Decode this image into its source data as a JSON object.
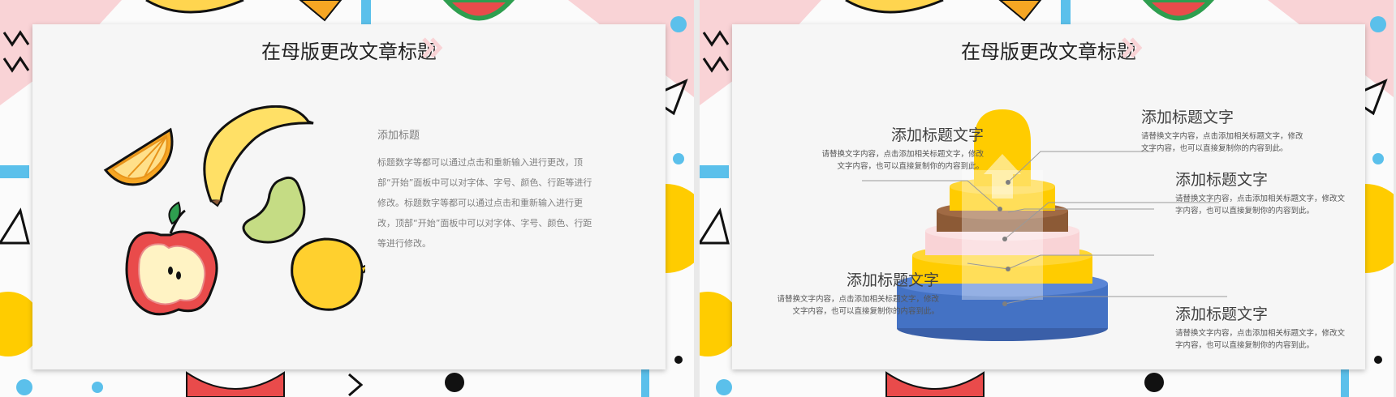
{
  "slide_left": {
    "title": "在母版更改文章标题",
    "subheading": "添加标题",
    "body": "标题数字等都可以通过点击和重新输入进行更改，顶部“开始”面板中可以对字体、字号、颜色、行距等进行修改。标题数字等都可以通过点击和重新输入进行更改，顶部“开始”面板中可以对字体、字号、颜色、行距等进行修改。"
  },
  "slide_right": {
    "title": "在母版更改文章标题",
    "items": [
      {
        "heading": "添加标题文字",
        "text": "请替换文字内容，点击添加相关标题文字，修改文字内容，也可以直接复制你的内容到此。"
      },
      {
        "heading": "添加标题文字",
        "text": "请替换文字内容，点击添加相关标题文字，修改文字内容，也可以直接复制你的内容到此。"
      },
      {
        "heading": "添加标题文字",
        "text": "请替换文字内容，点击添加相关标题文字，修改文字内容，也可以直接复制你的内容到此。"
      },
      {
        "heading": "添加标题文字",
        "text": "请替换文字内容，点击添加相关标题文字，修改文字内容，也可以直接复制你的内容到此。"
      },
      {
        "heading": "添加标题文字",
        "text": "请替换文字内容，点击添加相关标题文字，修改文字内容，也可以直接复制你的内容到此。"
      }
    ]
  },
  "colors": {
    "yellow": "#FFCC00",
    "pink": "#F9D3D6",
    "blue": "#4472C4",
    "sky": "#5BC0EB",
    "brown": "#8C5A36"
  },
  "icons": [
    "orange-slice-icon",
    "banana-icon",
    "pear-icon",
    "apple-icon",
    "lemon-icon",
    "watermelon-icon",
    "chevron-icon"
  ]
}
